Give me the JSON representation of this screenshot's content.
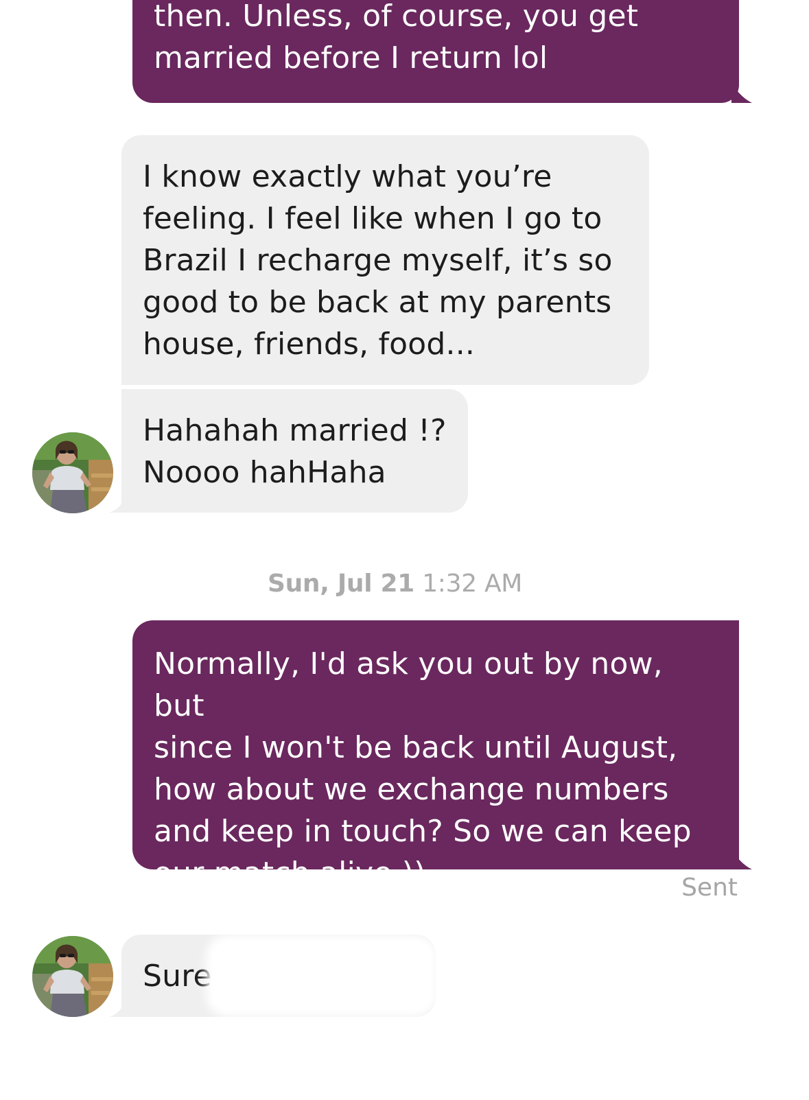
{
  "conversation": {
    "messages": [
      {
        "id": "m1",
        "direction": "sent",
        "text": "then. Unless, of course, you get\nmarried before I return lol"
      },
      {
        "id": "m2",
        "direction": "received",
        "text": "I know exactly what you’re\nfeeling. I feel like when I go to\nBrazil I recharge myself, it’s so\ngood to be back at my parents\nhouse, friends, food..."
      },
      {
        "id": "m3",
        "direction": "received",
        "text": "Hahahah married !?\nNoooo hahHaha"
      },
      {
        "id": "m4",
        "direction": "sent",
        "text": "Normally, I'd ask you out by now, but\nsince I won't be back until August,\nhow about we exchange numbers\nand keep in touch? So we can keep\nour match alive ))"
      },
      {
        "id": "m5",
        "direction": "received",
        "text": "Sure,"
      }
    ],
    "timestamp": {
      "day": "Sun, Jul 21",
      "time": "1:32 AM"
    },
    "status": "Sent"
  },
  "colors": {
    "sent_bubble": "#6a285e",
    "received_bubble": "#efefef",
    "meta_text": "#ababab"
  },
  "icons": {
    "avatar": "profile-photo-avatar"
  }
}
